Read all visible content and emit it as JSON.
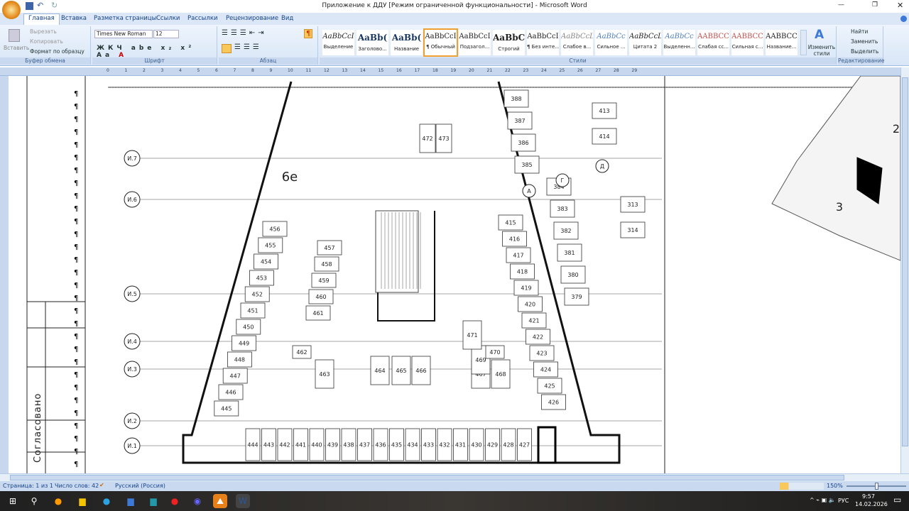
{
  "window": {
    "title": "Приложение к ДДУ [Режим ограниченной функциональности] - Microsoft Word"
  },
  "tabs": [
    "Главная",
    "Вставка",
    "Разметка страницы",
    "Ссылки",
    "Рассылки",
    "Рецензирование",
    "Вид"
  ],
  "clipboard": {
    "paste": "Вставить",
    "cut": "Вырезать",
    "copy": "Копировать",
    "format_painter": "Формат по образцу",
    "label": "Буфер обмена"
  },
  "font": {
    "name": "Times New Roman",
    "size": "12",
    "label": "Шрифт"
  },
  "paragraph": {
    "label": "Абзац"
  },
  "styles": {
    "label": "Стили",
    "change": "Изменить стили",
    "items": [
      {
        "preview": "AaBbCcI",
        "name": "Выделение"
      },
      {
        "preview": "AaBb(",
        "name": "Заголово..."
      },
      {
        "preview": "AaBb(",
        "name": "Название"
      },
      {
        "preview": "AaBbCcI",
        "name": "¶ Обычный"
      },
      {
        "preview": "AaBbCcI",
        "name": "Подзагол..."
      },
      {
        "preview": "AaBbCcl",
        "name": "Строгий"
      },
      {
        "preview": "AaBbCcI",
        "name": "¶ Без инте..."
      },
      {
        "preview": "AaBbCcL",
        "name": "Слабое в..."
      },
      {
        "preview": "AaBbCc",
        "name": "Сильное ..."
      },
      {
        "preview": "AaBbCcL",
        "name": "Цитата 2"
      },
      {
        "preview": "AaBbCc",
        "name": "Выделенн..."
      },
      {
        "preview": "AABBCC",
        "name": "Слабая сс..."
      },
      {
        "preview": "AABBCC",
        "name": "Сильная с..."
      },
      {
        "preview": "AABBCC",
        "name": "Название..."
      }
    ]
  },
  "editing": {
    "find": "Найти",
    "replace": "Заменить",
    "select": "Выделить",
    "label": "Редактирование"
  },
  "document": {
    "sidebar_text": "Согласовано",
    "section_label": "6е",
    "axes": [
      "И.7",
      "И.6",
      "И.5",
      "И.4",
      "И.3",
      "И.2",
      "И.1"
    ],
    "bottom_row": [
      "444",
      "443",
      "442",
      "441",
      "440",
      "439",
      "438",
      "437",
      "436",
      "435",
      "434",
      "433",
      "432",
      "431",
      "430",
      "429",
      "428",
      "427"
    ],
    "left_column": [
      "456",
      "455",
      "454",
      "453",
      "452",
      "451",
      "450",
      "449",
      "448",
      "447",
      "446",
      "445"
    ],
    "inner_left": [
      "457",
      "458",
      "459",
      "460",
      "461"
    ],
    "center_row": [
      "462",
      "463",
      "464",
      "465",
      "466",
      "467",
      "468",
      "469",
      "470",
      "471"
    ],
    "top": [
      "472",
      "473"
    ],
    "right_column": [
      "415",
      "416",
      "417",
      "418",
      "419",
      "420",
      "421",
      "422",
      "423",
      "424",
      "425",
      "426"
    ],
    "far_right": [
      "388",
      "387",
      "386",
      "385",
      "384",
      "383",
      "382",
      "381",
      "380",
      "379"
    ],
    "far_right2": [
      "413",
      "414",
      "313",
      "314"
    ],
    "axis_letters": [
      "А",
      "Г",
      "Д"
    ],
    "map_labels": [
      "2",
      "3"
    ]
  },
  "status": {
    "page": "Страница: 1 из 1",
    "words": "Число слов: 42",
    "language": "Русский (Россия)",
    "zoom": "150%"
  },
  "tray": {
    "lang": "РУС",
    "time": "9:57",
    "date": "14.02.2026"
  }
}
